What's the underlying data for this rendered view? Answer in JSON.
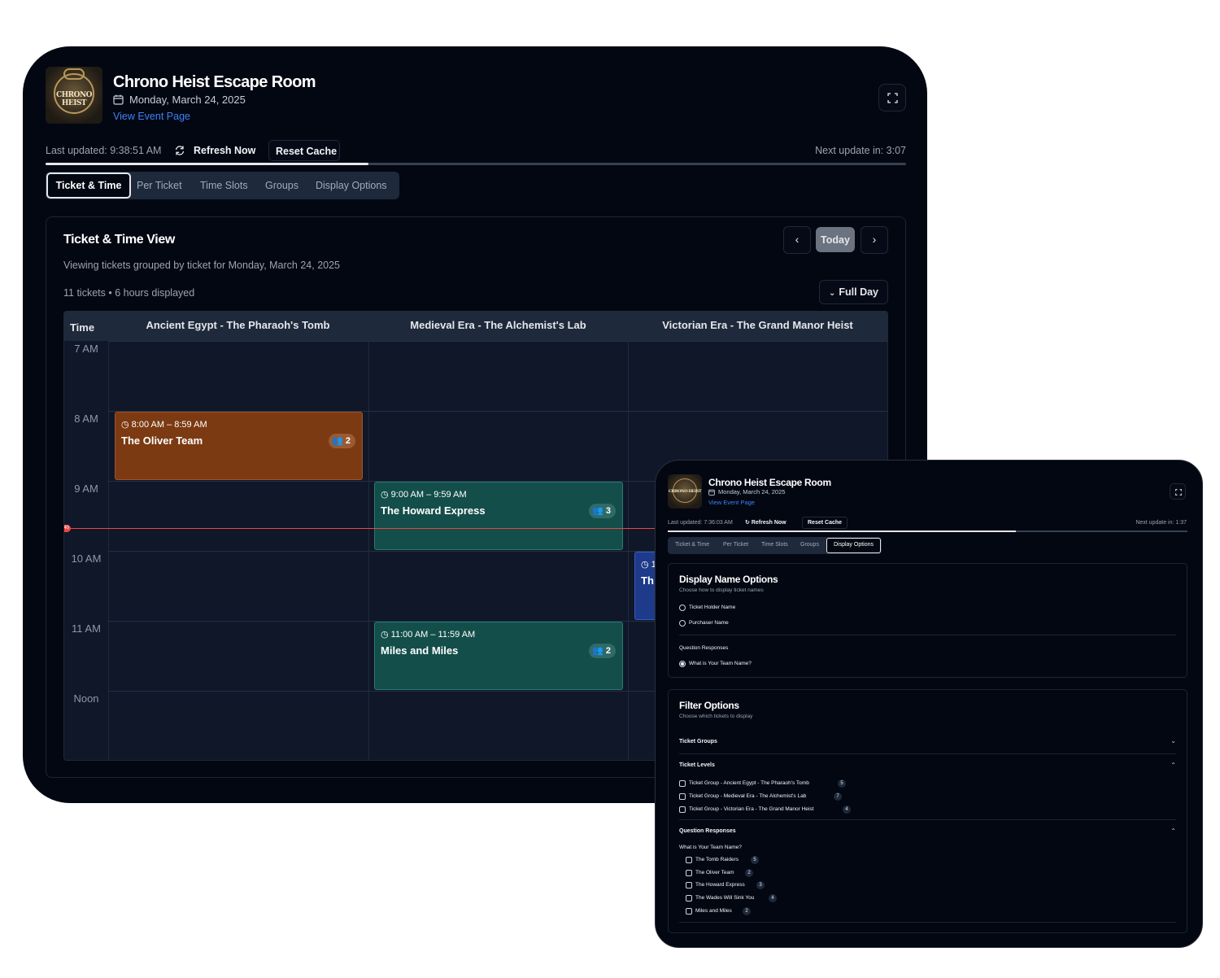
{
  "main": {
    "app_title": "Chrono Heist Escape Room",
    "logo_text": "CHRONO HEIST",
    "date": "Monday, March 24, 2025",
    "event_link": "View Event Page",
    "last_updated": "Last updated: 9:38:51 AM",
    "refresh_label": "Refresh Now",
    "reset_label": "Reset Cache",
    "next_update": "Next update in: 3:07",
    "progress_fraction": 0.375,
    "tabs": [
      "Ticket & Time",
      "Per Ticket",
      "Time Slots",
      "Groups",
      "Display Options"
    ],
    "active_tab": "Ticket & Time",
    "view_title": "Ticket & Time View",
    "view_subtitle": "Viewing tickets grouped by ticket for Monday, March 24, 2025",
    "summary": "11 tickets • 6 hours displayed",
    "today_label": "Today",
    "range_label": "Full Day",
    "time_header": "Time",
    "columns": [
      "Ancient Egypt - The Pharaoh's Tomb",
      "Medieval Era - The Alchemist's Lab",
      "Victorian Era - The Grand Manor Heist"
    ],
    "time_labels": [
      "7 AM",
      "8 AM",
      "9 AM",
      "10 AM",
      "11 AM",
      "Noon"
    ],
    "now_marker_label": "40",
    "events": [
      {
        "time": "8:00 AM – 8:59 AM",
        "name": "The Oliver Team",
        "count": "2"
      },
      {
        "time": "9:00 AM – 9:59 AM",
        "name": "The Howard Express",
        "count": "3"
      },
      {
        "time": "11:00 AM – 11:59 AM",
        "name": "Miles and Miles",
        "count": "2"
      },
      {
        "time": "1",
        "name": "Th",
        "count": ""
      }
    ]
  },
  "second": {
    "app_title": "Chrono Heist Escape Room",
    "date": "Monday, March 24, 2025",
    "event_link": "View Event Page",
    "last_updated": "Last updated: 7:36:03 AM",
    "refresh_label": "Refresh Now",
    "reset_label": "Reset Cache",
    "next_update": "Next update in: 1:37",
    "progress_fraction": 0.67,
    "tabs": [
      "Ticket & Time",
      "Per Ticket",
      "Time Slots",
      "Groups",
      "Display Options"
    ],
    "active_tab": "Display Options",
    "display_title": "Display Name Options",
    "display_subtitle": "Choose how to display ticket names",
    "name_options": [
      "Ticket Holder Name",
      "Purchaser Name"
    ],
    "question_responses_label": "Question Responses",
    "question_option": "What is Your Team Name?",
    "filter_title": "Filter Options",
    "filter_subtitle": "Choose which tickets to display",
    "ticket_groups_label": "Ticket Groups",
    "ticket_levels_label": "Ticket Levels",
    "ticket_levels": [
      {
        "label": "Ticket Group - Ancient Egypt - The Pharaoh's Tomb",
        "count": "5"
      },
      {
        "label": "Ticket Group - Medieval Era - The Alchemist's Lab",
        "count": "7"
      },
      {
        "label": "Ticket Group - Victorian Era - The Grand Manor Heist",
        "count": "4"
      }
    ],
    "question_filter_label": "Question Responses",
    "question_filter_sub": "What is Your Team Name?",
    "teams": [
      {
        "label": "The Tomb Raiders",
        "count": "5"
      },
      {
        "label": "The Oliver Team",
        "count": "2"
      },
      {
        "label": "The Howard Express",
        "count": "3"
      },
      {
        "label": "The Wades Will Sink You",
        "count": "4"
      },
      {
        "label": "Miles and Miles",
        "count": "2"
      }
    ]
  }
}
